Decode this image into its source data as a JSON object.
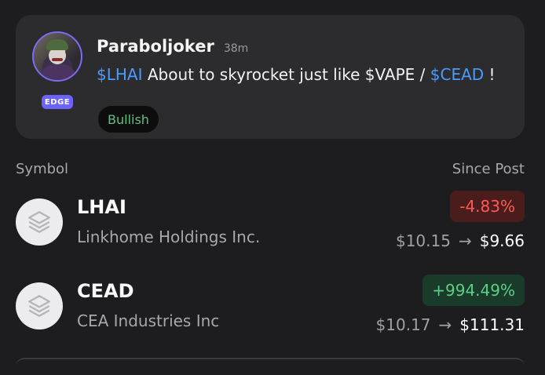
{
  "post": {
    "username": "Paraboljoker",
    "time": "38m",
    "badge": "EDGE",
    "body": {
      "tag1": "$LHAI",
      "middle": " About to skyrocket just like $VAPE / ",
      "tag2": "$CEAD",
      "end": " !"
    },
    "sentiment": "Bullish"
  },
  "table": {
    "col_symbol": "Symbol",
    "col_since": "Since Post",
    "rows": [
      {
        "ticker": "LHAI",
        "company": "Linkhome Holdings Inc.",
        "change": "-4.83%",
        "from": "$10.15",
        "to": "$9.66",
        "icon": "layers-icon"
      },
      {
        "ticker": "CEAD",
        "company": "CEA Industries Inc",
        "change": "+994.49%",
        "from": "$10.17",
        "to": "$111.31",
        "icon": "layers-icon"
      }
    ]
  },
  "colors": {
    "background": "#1d1d1f",
    "card": "#2c2c2e",
    "cashtag": "#4a9bff",
    "bullish": "#58c47f",
    "negative": "#ff5a52",
    "positive": "#5ccf87",
    "edge_badge": "#6c63ff"
  }
}
